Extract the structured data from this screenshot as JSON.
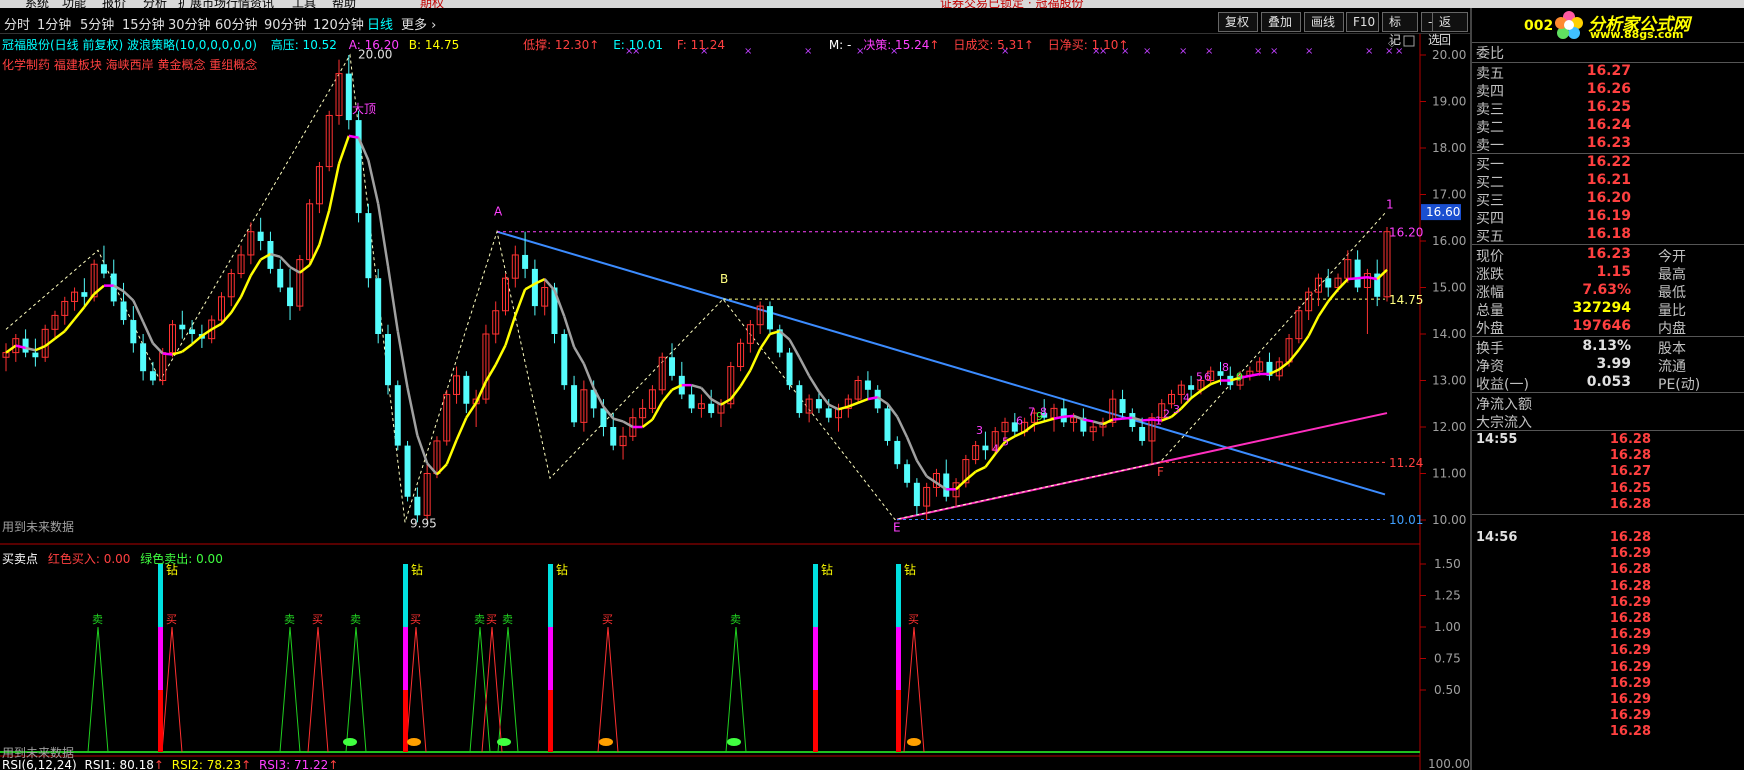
{
  "menu": {
    "items": [
      "系统",
      "功能",
      "报价",
      "分析",
      "扩展市场行情",
      "资讯",
      "工具",
      "帮助"
    ],
    "active": "期权",
    "notice": "证券交易已锁定 · 冠福股份"
  },
  "periods": [
    {
      "label": "分时",
      "active": false
    },
    {
      "label": "1分钟",
      "active": false
    },
    {
      "label": "5分钟",
      "active": false
    },
    {
      "label": "15分钟",
      "active": false
    },
    {
      "label": "30分钟",
      "active": false
    },
    {
      "label": "60分钟",
      "active": false
    },
    {
      "label": "90分钟",
      "active": false
    },
    {
      "label": "120分钟",
      "active": false
    },
    {
      "label": "日线",
      "active": true
    },
    {
      "label": "更多",
      "active": false
    }
  ],
  "toolbar": [
    "复权",
    "叠加",
    "画线",
    "F10",
    "标记",
    "-自选",
    "返回"
  ],
  "main_info": {
    "title": "冠福股份(日线 前复权) 波浪策略(10,0,0,0,0,0)",
    "high_label": "高压: 10.52",
    "a": "A: 16.20",
    "b": "B: 14.75",
    "low_label": "低撑: 12.30",
    "e": "E: 10.01",
    "f": "F: 11.24",
    "m": "M: -",
    "decision": "决策: 15.24",
    "daily_vol": "日成交: 5.31",
    "daily_net": "日净买: 1.10",
    "concepts": "化学制药 福建板块 海峡西岸 黄金概念 重组概念",
    "future_note": "用到未来数据"
  },
  "sub_info": {
    "title": "买卖点",
    "red": "红色买入: 0.00",
    "green": "绿色卖出: 0.00",
    "future_note": "用到未来数据"
  },
  "rsi_info": {
    "title": "RSI(6,12,24)",
    "rsi1": "RSI1: 80.18",
    "rsi2": "RSI2: 78.23",
    "rsi3": "RSI3: 71.22"
  },
  "axis": {
    "main_ticks": [
      "20.00",
      "19.00",
      "18.00",
      "17.00",
      "16.00",
      "15.00",
      "14.00",
      "13.00",
      "12.00",
      "11.00",
      "10.00"
    ],
    "sub_ticks": [
      "1.50",
      "1.25",
      "1.00",
      "0.75",
      "0.50"
    ],
    "rsi_tick": "100.00",
    "current_price_box": "16.60"
  },
  "annotations": {
    "peak_high": "20.00",
    "peak_label": "大顶",
    "trough_low": "9.95",
    "point_a": "A",
    "point_b": "B",
    "point_e": "E",
    "point_f": "F",
    "point_1": "1",
    "level_1620": "16.20",
    "level_1475": "14.75",
    "level_1124": "11.24",
    "level_1001": "10.01",
    "diamond_label": "钻",
    "buy_label": "买",
    "sell_label": "卖"
  },
  "colors": {
    "up": "#ff3232",
    "down": "#54fcfc",
    "ma_yellow": "#ffff00",
    "ma_gray": "#a0a0a0",
    "ma_magenta": "#ff00ff",
    "trend_blue": "#3c8cff",
    "trend_magenta": "#ff2fbf",
    "price_red": "#ff4040"
  },
  "logo": {
    "title": "分析家公式网",
    "url": "www.88gs.com",
    "stock_code": "002"
  },
  "quote": {
    "weibi": "委比",
    "asks": [
      {
        "label": "卖五",
        "price": "16.27"
      },
      {
        "label": "卖四",
        "price": "16.26"
      },
      {
        "label": "卖三",
        "price": "16.25"
      },
      {
        "label": "卖二",
        "price": "16.24"
      },
      {
        "label": "卖一",
        "price": "16.23"
      }
    ],
    "bids": [
      {
        "label": "买一",
        "price": "16.22"
      },
      {
        "label": "买二",
        "price": "16.21"
      },
      {
        "label": "买三",
        "price": "16.20"
      },
      {
        "label": "买四",
        "price": "16.19"
      },
      {
        "label": "买五",
        "price": "16.18"
      }
    ],
    "stats": [
      {
        "l1": "现价",
        "v1": "16.23",
        "l2": "今开",
        "c1": "#ff4040"
      },
      {
        "l1": "涨跌",
        "v1": "1.15",
        "l2": "最高",
        "c1": "#ff4040"
      },
      {
        "l1": "涨幅",
        "v1": "7.63%",
        "l2": "最低",
        "c1": "#ff4040"
      },
      {
        "l1": "总量",
        "v1": "327294",
        "l2": "量比",
        "c1": "#ffff00"
      },
      {
        "l1": "外盘",
        "v1": "197646",
        "l2": "内盘",
        "c1": "#ff4040"
      }
    ],
    "stats2": [
      {
        "l1": "换手",
        "v1": "8.13%",
        "l2": "股本",
        "c1": "#e0e0e0"
      },
      {
        "l1": "净资",
        "v1": "3.99",
        "l2": "流通",
        "c1": "#e0e0e0"
      },
      {
        "l1": "收益(一)",
        "v1": "0.053",
        "l2": "PE(动)",
        "c1": "#e0e0e0"
      }
    ],
    "flow": [
      "净流入额",
      "大宗流入"
    ],
    "ticks": [
      {
        "time": "14:55",
        "prices": [
          "16.28",
          "16.28",
          "16.27",
          "16.25",
          "16.28"
        ]
      },
      {
        "time": "14:56",
        "prices": [
          "16.28",
          "16.29",
          "16.28",
          "16.28",
          "16.29",
          "16.28",
          "16.29",
          "16.29",
          "16.29",
          "16.29",
          "16.29",
          "16.29",
          "16.28"
        ]
      }
    ]
  },
  "chart_data": {
    "type": "candlestick",
    "title": "冠福股份(日线 前复权)",
    "ylim": [
      9.9,
      20.3
    ],
    "candles": [
      [
        13.5,
        13.8,
        13.2,
        13.6
      ],
      [
        13.6,
        14.0,
        13.4,
        13.9
      ],
      [
        13.9,
        14.1,
        13.5,
        13.6
      ],
      [
        13.6,
        13.9,
        13.3,
        13.5
      ],
      [
        13.5,
        14.2,
        13.4,
        14.1
      ],
      [
        14.1,
        14.5,
        13.9,
        14.4
      ],
      [
        14.4,
        14.8,
        14.2,
        14.7
      ],
      [
        14.7,
        15.0,
        14.5,
        14.9
      ],
      [
        14.9,
        15.2,
        14.6,
        14.8
      ],
      [
        14.8,
        15.6,
        14.7,
        15.5
      ],
      [
        15.5,
        15.9,
        15.2,
        15.3
      ],
      [
        15.3,
        15.6,
        14.6,
        14.7
      ],
      [
        14.7,
        15.1,
        14.2,
        14.3
      ],
      [
        14.3,
        14.6,
        13.6,
        13.8
      ],
      [
        13.8,
        14.0,
        13.0,
        13.2
      ],
      [
        13.2,
        13.4,
        12.9,
        13.0
      ],
      [
        13.0,
        13.7,
        12.9,
        13.6
      ],
      [
        13.6,
        14.3,
        13.5,
        14.2
      ],
      [
        14.2,
        14.5,
        13.9,
        14.1
      ],
      [
        14.1,
        14.3,
        13.8,
        14.0
      ],
      [
        14.0,
        14.2,
        13.7,
        13.9
      ],
      [
        13.9,
        14.4,
        13.8,
        14.3
      ],
      [
        14.3,
        14.9,
        14.2,
        14.8
      ],
      [
        14.8,
        15.4,
        14.6,
        15.3
      ],
      [
        15.3,
        15.9,
        15.2,
        15.7
      ],
      [
        15.7,
        16.4,
        15.5,
        16.2
      ],
      [
        16.2,
        16.5,
        15.8,
        16.0
      ],
      [
        16.0,
        16.2,
        15.3,
        15.4
      ],
      [
        15.4,
        15.6,
        14.9,
        15.0
      ],
      [
        15.0,
        15.4,
        14.3,
        14.6
      ],
      [
        14.6,
        15.7,
        14.5,
        15.6
      ],
      [
        15.6,
        16.9,
        15.5,
        16.8
      ],
      [
        16.8,
        17.7,
        16.6,
        17.6
      ],
      [
        17.6,
        18.8,
        17.5,
        18.7
      ],
      [
        18.7,
        19.9,
        18.5,
        19.6
      ],
      [
        19.6,
        20.0,
        18.4,
        18.6
      ],
      [
        18.6,
        18.8,
        16.4,
        16.6
      ],
      [
        16.6,
        16.8,
        15.0,
        15.2
      ],
      [
        15.2,
        15.4,
        13.8,
        14.0
      ],
      [
        14.0,
        14.2,
        12.7,
        12.9
      ],
      [
        12.9,
        13.0,
        11.5,
        11.6
      ],
      [
        11.6,
        11.7,
        10.4,
        10.5
      ],
      [
        10.5,
        10.7,
        9.95,
        10.1
      ],
      [
        10.1,
        11.2,
        10.0,
        11.0
      ],
      [
        11.0,
        11.8,
        10.9,
        11.7
      ],
      [
        11.7,
        12.8,
        11.6,
        12.7
      ],
      [
        12.7,
        13.3,
        12.5,
        13.1
      ],
      [
        13.1,
        13.2,
        12.3,
        12.5
      ],
      [
        12.5,
        12.8,
        12.0,
        12.6
      ],
      [
        12.6,
        14.2,
        12.5,
        14.0
      ],
      [
        14.0,
        14.7,
        13.8,
        14.5
      ],
      [
        14.5,
        15.3,
        14.4,
        15.2
      ],
      [
        15.2,
        15.9,
        15.0,
        15.7
      ],
      [
        15.7,
        16.2,
        15.2,
        15.4
      ],
      [
        15.4,
        15.6,
        14.4,
        14.6
      ],
      [
        14.6,
        15.2,
        14.4,
        15.0
      ],
      [
        15.0,
        15.1,
        13.8,
        14.0
      ],
      [
        14.0,
        14.1,
        12.8,
        12.9
      ],
      [
        12.9,
        13.1,
        12.0,
        12.1
      ],
      [
        12.1,
        13.0,
        11.9,
        12.8
      ],
      [
        12.8,
        13.0,
        12.2,
        12.4
      ],
      [
        12.4,
        12.6,
        11.8,
        12.0
      ],
      [
        12.0,
        12.3,
        11.5,
        11.6
      ],
      [
        11.6,
        12.0,
        11.3,
        11.8
      ],
      [
        11.8,
        12.4,
        11.7,
        12.2
      ],
      [
        12.2,
        12.6,
        12.0,
        12.4
      ],
      [
        12.4,
        12.9,
        12.3,
        12.8
      ],
      [
        12.8,
        13.6,
        12.7,
        13.5
      ],
      [
        13.5,
        13.8,
        13.0,
        13.1
      ],
      [
        13.1,
        13.4,
        12.6,
        12.7
      ],
      [
        12.7,
        12.9,
        12.3,
        12.4
      ],
      [
        12.4,
        12.7,
        12.2,
        12.5
      ],
      [
        12.5,
        12.8,
        12.2,
        12.3
      ],
      [
        12.3,
        12.6,
        12.0,
        12.5
      ],
      [
        12.5,
        13.4,
        12.4,
        13.3
      ],
      [
        13.3,
        13.9,
        13.2,
        13.8
      ],
      [
        13.8,
        14.3,
        13.6,
        14.2
      ],
      [
        14.2,
        14.7,
        14.0,
        14.6
      ],
      [
        14.6,
        14.7,
        14.0,
        14.1
      ],
      [
        14.1,
        14.2,
        13.5,
        13.6
      ],
      [
        13.6,
        13.7,
        12.8,
        12.9
      ],
      [
        12.9,
        13.0,
        12.2,
        12.3
      ],
      [
        12.3,
        12.7,
        12.1,
        12.6
      ],
      [
        12.6,
        12.8,
        12.3,
        12.4
      ],
      [
        12.4,
        12.6,
        12.1,
        12.2
      ],
      [
        12.2,
        12.5,
        11.9,
        12.4
      ],
      [
        12.4,
        12.7,
        12.2,
        12.6
      ],
      [
        12.6,
        13.1,
        12.5,
        13.0
      ],
      [
        13.0,
        13.2,
        12.6,
        12.8
      ],
      [
        12.8,
        12.9,
        12.3,
        12.4
      ],
      [
        12.4,
        12.5,
        11.6,
        11.7
      ],
      [
        11.7,
        11.8,
        11.1,
        11.2
      ],
      [
        11.2,
        11.3,
        10.7,
        10.8
      ],
      [
        10.8,
        10.9,
        10.1,
        10.3
      ],
      [
        10.3,
        10.8,
        10.0,
        10.7
      ],
      [
        10.7,
        11.1,
        10.5,
        11.0
      ],
      [
        11.0,
        11.3,
        10.4,
        10.5
      ],
      [
        10.5,
        10.9,
        10.3,
        10.8
      ],
      [
        10.8,
        11.4,
        10.7,
        11.3
      ],
      [
        11.3,
        11.7,
        11.2,
        11.6
      ],
      [
        11.6,
        11.9,
        11.3,
        11.5
      ],
      [
        11.5,
        12.0,
        11.4,
        11.9
      ],
      [
        11.9,
        12.2,
        11.7,
        12.1
      ],
      [
        12.1,
        12.3,
        11.8,
        11.9
      ],
      [
        11.9,
        12.2,
        11.8,
        12.1
      ],
      [
        12.1,
        12.4,
        11.9,
        12.3
      ],
      [
        12.3,
        12.6,
        12.1,
        12.2
      ],
      [
        12.2,
        12.5,
        11.9,
        12.4
      ],
      [
        12.4,
        12.6,
        12.0,
        12.1
      ],
      [
        12.1,
        12.3,
        11.9,
        12.2
      ],
      [
        12.2,
        12.4,
        11.8,
        11.9
      ],
      [
        11.9,
        12.1,
        11.7,
        12.0
      ],
      [
        12.0,
        12.2,
        11.8,
        12.1
      ],
      [
        12.1,
        12.8,
        12.0,
        12.6
      ],
      [
        12.6,
        12.8,
        12.2,
        12.3
      ],
      [
        12.3,
        12.4,
        11.9,
        12.0
      ],
      [
        12.0,
        12.2,
        11.6,
        11.7
      ],
      [
        11.7,
        12.3,
        11.2,
        12.2
      ],
      [
        12.2,
        12.6,
        12.1,
        12.5
      ],
      [
        12.5,
        12.8,
        12.4,
        12.7
      ],
      [
        12.7,
        13.0,
        12.5,
        12.9
      ],
      [
        12.9,
        13.1,
        12.6,
        12.8
      ],
      [
        12.8,
        13.1,
        12.7,
        13.0
      ],
      [
        13.0,
        13.3,
        12.9,
        13.2
      ],
      [
        13.2,
        13.4,
        12.9,
        13.1
      ],
      [
        13.1,
        13.3,
        12.8,
        12.9
      ],
      [
        12.9,
        13.2,
        12.8,
        13.1
      ],
      [
        13.1,
        13.3,
        13.0,
        13.2
      ],
      [
        13.2,
        13.5,
        13.1,
        13.4
      ],
      [
        13.4,
        13.6,
        13.0,
        13.1
      ],
      [
        13.1,
        13.5,
        13.0,
        13.4
      ],
      [
        13.4,
        14.0,
        13.3,
        13.9
      ],
      [
        13.9,
        14.6,
        13.8,
        14.5
      ],
      [
        14.5,
        15.0,
        14.3,
        14.9
      ],
      [
        14.9,
        15.3,
        14.6,
        15.2
      ],
      [
        15.2,
        15.4,
        14.8,
        15.0
      ],
      [
        15.0,
        15.3,
        14.9,
        15.2
      ],
      [
        15.2,
        15.8,
        15.1,
        15.6
      ],
      [
        15.6,
        15.8,
        14.9,
        15.0
      ],
      [
        15.0,
        15.4,
        14.0,
        15.3
      ],
      [
        15.3,
        15.6,
        14.6,
        14.8
      ],
      [
        14.8,
        16.3,
        14.7,
        16.2
      ]
    ]
  }
}
